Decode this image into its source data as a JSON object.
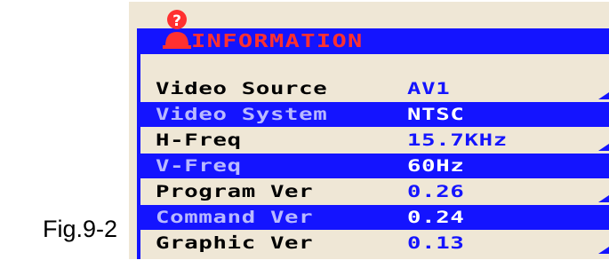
{
  "caption": "Fig.9-2",
  "osd": {
    "title": "INFORMATION",
    "title_icon": "question-person-icon",
    "rows": [
      {
        "label": "Video Source",
        "value": "AV1",
        "highlighted": false
      },
      {
        "label": "Video System",
        "value": "NTSC",
        "highlighted": true
      },
      {
        "label": "H-Freq",
        "value": "15.7KHz",
        "highlighted": false
      },
      {
        "label": "V-Freq",
        "value": "60Hz",
        "highlighted": true
      },
      {
        "label": "Program Ver",
        "value": "0.26",
        "highlighted": false
      },
      {
        "label": "Command Ver",
        "value": "0.24",
        "highlighted": true
      },
      {
        "label": "Graphic Ver",
        "value": "0.13",
        "highlighted": false
      }
    ]
  },
  "colors": {
    "osd_blue": "#1414ff",
    "title_red": "#ff3030",
    "osd_background": "#efe7d6"
  }
}
